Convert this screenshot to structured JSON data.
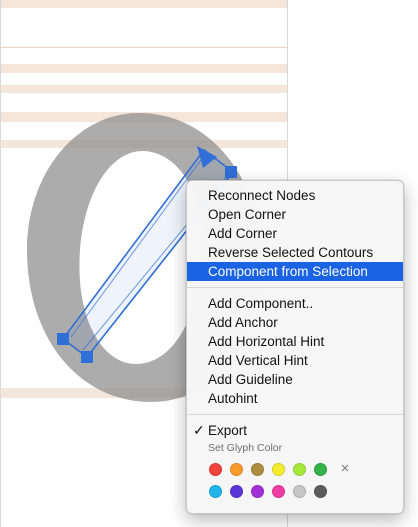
{
  "menu": {
    "group1": [
      {
        "label": "Reconnect Nodes"
      },
      {
        "label": "Open Corner"
      },
      {
        "label": "Add Corner"
      },
      {
        "label": "Reverse Selected Contours"
      },
      {
        "label": "Component from Selection",
        "highlighted": true
      }
    ],
    "group2": [
      {
        "label": "Add Component.."
      },
      {
        "label": "Add Anchor"
      },
      {
        "label": "Add Horizontal Hint"
      },
      {
        "label": "Add Vertical Hint"
      },
      {
        "label": "Add Guideline"
      },
      {
        "label": "Autohint"
      }
    ],
    "export": {
      "label": "Export",
      "checked": true,
      "check_glyph": "✓"
    },
    "glyph_color_caption": "Set Glyph Color",
    "colors_row1": [
      "#f0433a",
      "#f79a2a",
      "#b08d3e",
      "#f5ec2c",
      "#a5e83c",
      "#34b34a"
    ],
    "colors_row2": [
      "#1fb4ea",
      "#5b34d8",
      "#a22fd6",
      "#ef3da4",
      "#c6c6c6",
      "#5c5c5c"
    ],
    "clear_color_icon": "×"
  },
  "canvas": {
    "glyph_fill": "#8c8c8c",
    "selection_color": "#2f6fd6"
  }
}
